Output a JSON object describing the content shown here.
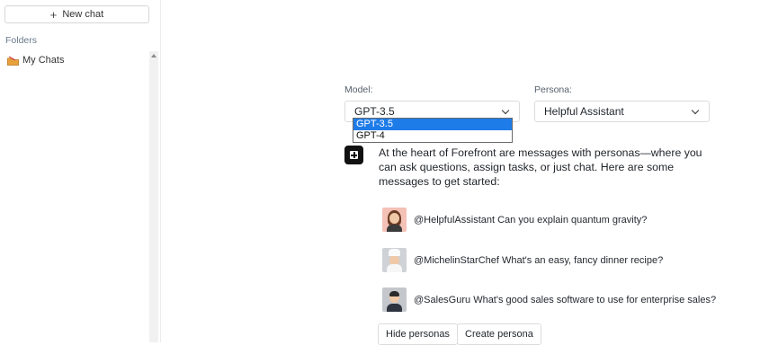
{
  "sidebar": {
    "new_chat_label": "New chat",
    "folders_label": "Folders",
    "items": [
      {
        "label": "My Chats",
        "icon": "folder-icon"
      }
    ]
  },
  "model": {
    "label": "Model:",
    "selected": "GPT-3.5",
    "options": [
      "GPT-3.5",
      "GPT-4"
    ]
  },
  "persona": {
    "label": "Persona:",
    "selected": "Helpful Assistant"
  },
  "intro": "At the heart of Forefront are messages with personas—where you can ask questions, assign tasks, or just chat. Here are some messages to get started:",
  "suggestions": [
    {
      "text": "@HelpfulAssistant Can you explain quantum gravity?"
    },
    {
      "text": "@MichelinStarChef What's an easy, fancy dinner recipe?"
    },
    {
      "text": "@SalesGuru What's good sales software to use for enterprise sales?"
    }
  ],
  "actions": {
    "hide_personas": "Hide personas",
    "create_persona": "Create persona"
  },
  "colors": {
    "accent": "#1e7ce8",
    "logo": "#111111"
  }
}
